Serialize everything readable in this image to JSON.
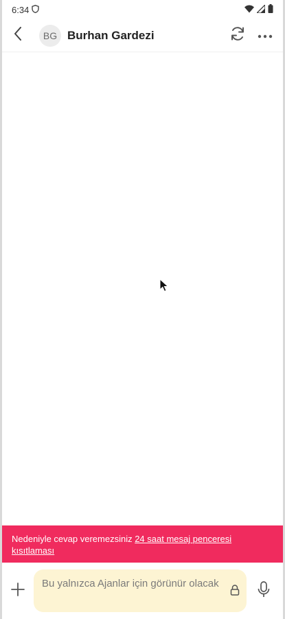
{
  "status_bar": {
    "time": "6:34"
  },
  "header": {
    "avatar_initials": "BG",
    "contact_name": "Burhan Gardezi"
  },
  "banner": {
    "text": "Nedeniyle cevap veremezsiniz ",
    "link": "24 saat mesaj penceresi kısıtlaması",
    "color": "#f02b5e"
  },
  "composer": {
    "placeholder": "Bu yalnızca Ajanlar için görünür olacak",
    "input_background": "#fdf4d3"
  },
  "icons": [
    "shield-icon",
    "wifi-icon",
    "signal-icon",
    "battery-icon",
    "back-icon",
    "refresh-icon",
    "more-icon",
    "add-icon",
    "lock-icon",
    "mic-icon",
    "cursor-icon"
  ]
}
